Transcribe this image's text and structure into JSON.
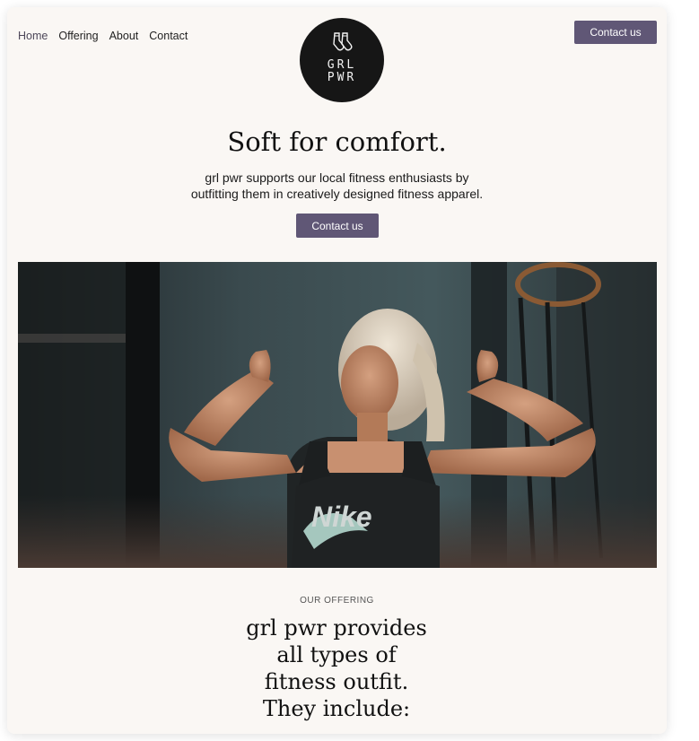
{
  "nav": {
    "items": [
      {
        "label": "Home",
        "active": true
      },
      {
        "label": "Offering",
        "active": false
      },
      {
        "label": "About",
        "active": false
      },
      {
        "label": "Contact",
        "active": false
      }
    ]
  },
  "logo": {
    "icon": "socks-icon",
    "line1": "GRL",
    "line2": "PWR"
  },
  "header": {
    "cta_label": "Contact us"
  },
  "hero": {
    "title": "Soft for comfort.",
    "subtitle_line1": "grl pwr supports our local fitness enthusiasts by",
    "subtitle_line2": "outfitting them in creatively designed fitness apparel.",
    "cta_label": "Contact us",
    "image": "woman-stretching-gym-photo",
    "shirt_text": "Nike"
  },
  "offering": {
    "eyebrow": "OUR OFFERING",
    "title_line1": "grl pwr provides",
    "title_line2": "all types of",
    "title_line3": "fitness outfit.",
    "title_line4": "They include:"
  },
  "colors": {
    "accent": "#605776",
    "background": "#faf7f4",
    "text": "#111111"
  }
}
